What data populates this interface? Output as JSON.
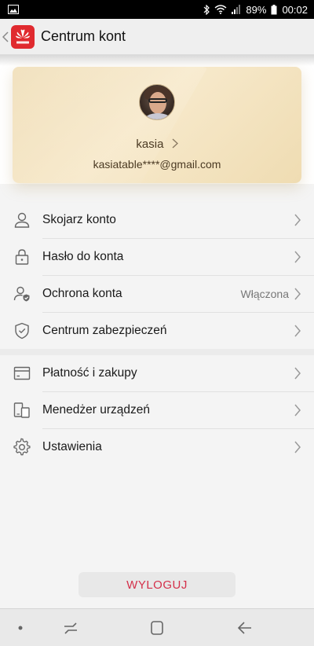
{
  "status_bar": {
    "battery": "89%",
    "time": "00:02"
  },
  "app_bar": {
    "title": "Centrum kont",
    "logo_text": "HUAWEI"
  },
  "profile": {
    "name": "kasia",
    "email": "kasiatable****@gmail.com"
  },
  "menu": {
    "group1": [
      {
        "label": "Skojarz konto",
        "icon": "person-icon"
      },
      {
        "label": "Hasło do konta",
        "icon": "lock-icon"
      },
      {
        "label": "Ochrona konta",
        "icon": "person-shield-icon",
        "value": "Włączona"
      },
      {
        "label": "Centrum zabezpieczeń",
        "icon": "shield-check-icon"
      }
    ],
    "group2": [
      {
        "label": "Płatność i zakupy",
        "icon": "card-icon"
      },
      {
        "label": "Menedżer urządzeń",
        "icon": "devices-icon"
      },
      {
        "label": "Ustawienia",
        "icon": "gear-icon"
      }
    ]
  },
  "logout_label": "WYLOGUJ",
  "colors": {
    "accent_red": "#d4304a",
    "brand_red": "#e02a2f",
    "card_gold": "#efdcb3"
  }
}
